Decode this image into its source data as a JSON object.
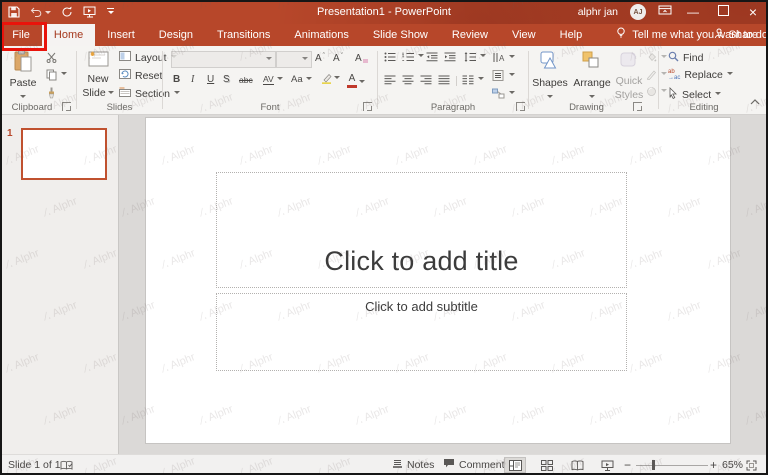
{
  "titlebar": {
    "title": "Presentation1 - PowerPoint",
    "user_name": "alphr jan",
    "user_initials": "AJ"
  },
  "tabs": {
    "items": [
      "File",
      "Home",
      "Insert",
      "Design",
      "Transitions",
      "Animations",
      "Slide Show",
      "Review",
      "View",
      "Help"
    ],
    "active": "Home",
    "annotated": "File"
  },
  "tellme": {
    "label": "Tell me what you want to do"
  },
  "share": {
    "label": "Share"
  },
  "ribbon": {
    "clipboard": {
      "group_label": "Clipboard",
      "paste_label": "Paste"
    },
    "slides": {
      "group_label": "Slides",
      "new_slide_line1": "New",
      "new_slide_line2": "Slide",
      "layout_label": "Layout",
      "reset_label": "Reset",
      "section_label": "Section"
    },
    "font": {
      "group_label": "Font",
      "bold": "B",
      "italic": "I",
      "underline": "U",
      "shadow": "S",
      "strikethrough": "abc",
      "char_spacing": "AV",
      "change_case": "Aa",
      "font_color": "A",
      "grow": "A",
      "shrink": "A",
      "clear": "A"
    },
    "paragraph": {
      "group_label": "Paragraph"
    },
    "drawing": {
      "group_label": "Drawing",
      "shapes_label": "Shapes",
      "arrange_label": "Arrange",
      "quick_styles_line1": "Quick",
      "quick_styles_line2": "Styles"
    },
    "editing": {
      "group_label": "Editing",
      "find_label": "Find",
      "replace_label": "Replace",
      "select_label": "Select"
    }
  },
  "slide_panel": {
    "slide_number": "1"
  },
  "canvas": {
    "title_placeholder": "Click to add title",
    "subtitle_placeholder": "Click to add subtitle"
  },
  "status_bar": {
    "slide_indicator": "Slide 1 of 1",
    "notes_label": "Notes",
    "comments_label": "Comments",
    "zoom_level": "65%"
  },
  "watermark": {
    "logo_glyph": "∕․",
    "text": "Alphr"
  },
  "colors": {
    "brand_red": "#B7472A",
    "annotation_red": "#E9130B",
    "thumbnail_border": "#C0512F"
  }
}
